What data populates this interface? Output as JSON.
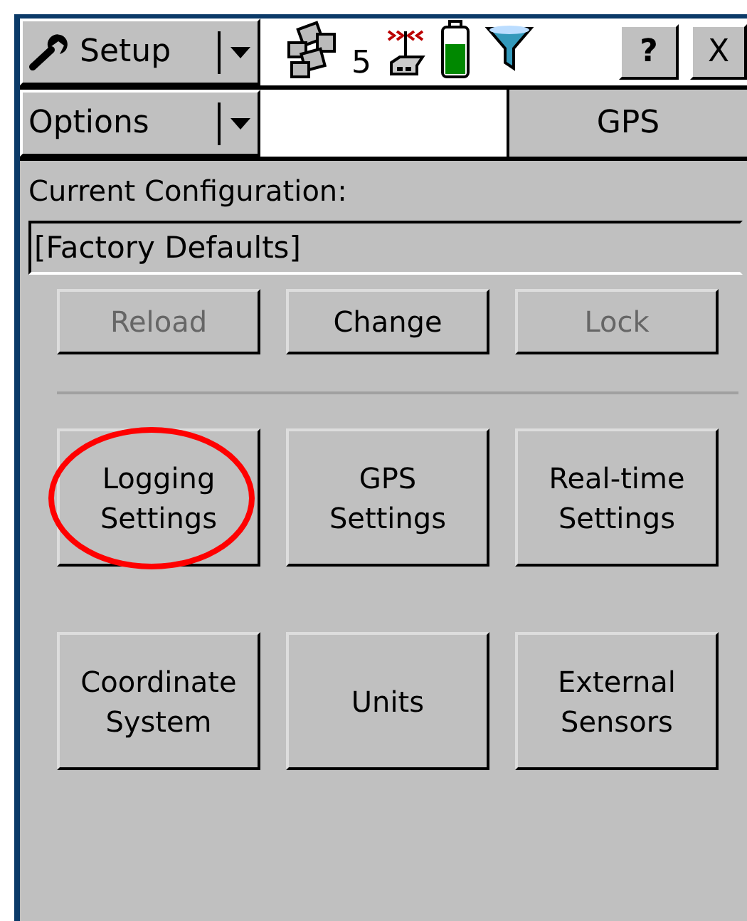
{
  "toolbar": {
    "menu_button": "Setup",
    "satellite_count": "5",
    "help_button": "?",
    "close_button": "X"
  },
  "options_bar": {
    "menu_button": "Options",
    "section_title": "GPS"
  },
  "configuration": {
    "label": "Current Configuration:",
    "value": "[Factory Defaults]"
  },
  "config_buttons": [
    {
      "label": "Reload",
      "disabled": true
    },
    {
      "label": "Change",
      "disabled": false
    },
    {
      "label": "Lock",
      "disabled": true
    }
  ],
  "settings_buttons": [
    {
      "label": "Logging\nSettings",
      "circled": true
    },
    {
      "label": "GPS\nSettings",
      "circled": false
    },
    {
      "label": "Real-time\nSettings",
      "circled": false
    },
    {
      "label": "Coordinate\nSystem",
      "circled": false
    },
    {
      "label": "Units",
      "circled": false
    },
    {
      "label": "External\nSensors",
      "circled": false
    }
  ]
}
